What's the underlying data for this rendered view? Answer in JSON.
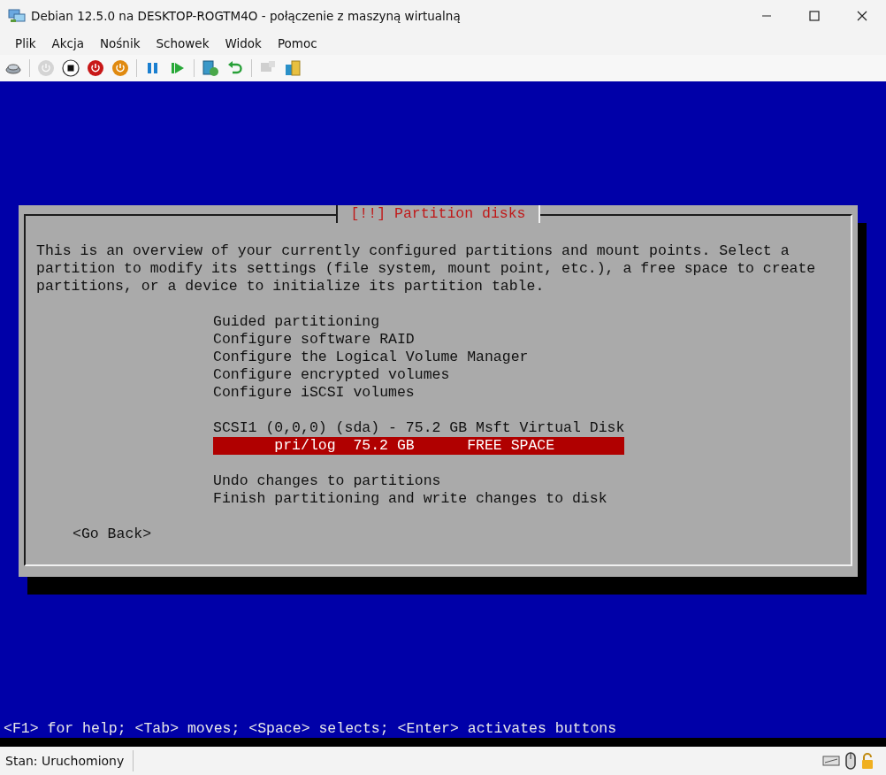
{
  "window": {
    "title": "Debian 12.5.0 na DESKTOP-ROGTM4O - połączenie z maszyną wirtualną"
  },
  "menu": [
    "Plik",
    "Akcja",
    "Nośnik",
    "Schowek",
    "Widok",
    "Pomoc"
  ],
  "toolbar": [
    {
      "kind": "ctrl-alt-del",
      "disabled": false
    },
    {
      "kind": "sep"
    },
    {
      "kind": "start",
      "disabled": true
    },
    {
      "kind": "turn-off",
      "disabled": false
    },
    {
      "kind": "shut-down",
      "disabled": false
    },
    {
      "kind": "save",
      "disabled": false
    },
    {
      "kind": "sep"
    },
    {
      "kind": "pause",
      "disabled": false
    },
    {
      "kind": "reset",
      "disabled": false
    },
    {
      "kind": "sep"
    },
    {
      "kind": "checkpoint",
      "disabled": false
    },
    {
      "kind": "revert",
      "disabled": false
    },
    {
      "kind": "sep"
    },
    {
      "kind": "enhanced",
      "disabled": true
    },
    {
      "kind": "share",
      "disabled": false
    }
  ],
  "dialog": {
    "title": "[!!] Partition disks",
    "text": "This is an overview of your currently configured partitions and mount points. Select a partition to modify its settings (file system, mount point, etc.), a free space to create partitions, or a device to initialize its partition table.",
    "groups": [
      [
        {
          "kind": "action",
          "label": "Guided partitioning",
          "selected": false
        },
        {
          "kind": "action",
          "label": "Configure software RAID",
          "selected": false
        },
        {
          "kind": "action",
          "label": "Configure the Logical Volume Manager",
          "selected": false
        },
        {
          "kind": "action",
          "label": "Configure encrypted volumes",
          "selected": false
        },
        {
          "kind": "action",
          "label": "Configure iSCSI volumes",
          "selected": false
        }
      ],
      [
        {
          "kind": "disk",
          "label": "SCSI1 (0,0,0) (sda) - 75.2 GB Msft Virtual Disk",
          "selected": false
        },
        {
          "kind": "partition",
          "label": "pri/log  75.2 GB      FREE SPACE",
          "selected": true
        }
      ],
      [
        {
          "kind": "action",
          "label": "Undo changes to partitions",
          "selected": false
        },
        {
          "kind": "action",
          "label": "Finish partitioning and write changes to disk",
          "selected": false
        }
      ]
    ],
    "button": "<Go Back>"
  },
  "help_line": "<F1> for help; <Tab> moves; <Space> selects; <Enter> activates buttons",
  "status_bar": {
    "status": "Stan: Uruchomiony"
  }
}
